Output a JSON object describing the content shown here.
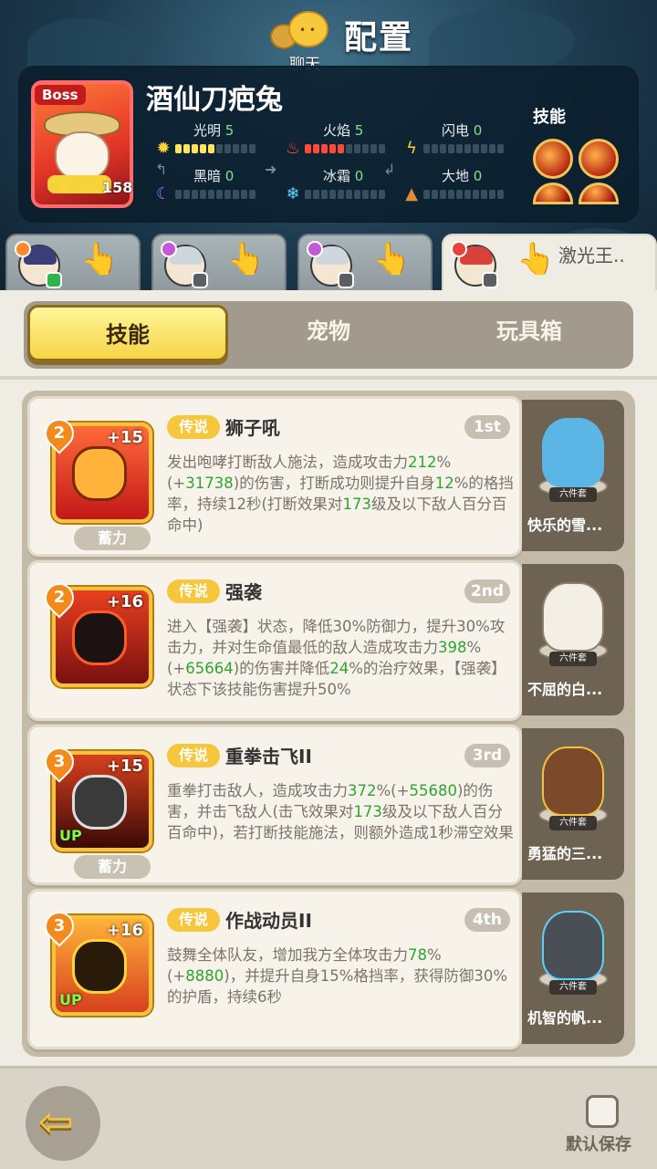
{
  "header": {
    "title": "配置",
    "chat_label": "聊天"
  },
  "boss": {
    "badge": "Boss",
    "name": "酒仙刀疤兔",
    "level": "158",
    "elements": [
      {
        "name": "光明",
        "value": "5",
        "icon": "sun-icon"
      },
      {
        "name": "火焰",
        "value": "5",
        "icon": "fire-icon"
      },
      {
        "name": "闪电",
        "value": "0",
        "icon": "lightning-icon"
      },
      {
        "name": "黑暗",
        "value": "0",
        "icon": "moon-icon"
      },
      {
        "name": "冰霜",
        "value": "0",
        "icon": "snowflake-icon"
      },
      {
        "name": "大地",
        "value": "0",
        "icon": "mountain-icon"
      }
    ],
    "skills_label": "技能"
  },
  "team_tabs": [
    {
      "name": ""
    },
    {
      "name": ""
    },
    {
      "name": ""
    },
    {
      "name": "激光王.."
    }
  ],
  "segments": [
    "技能",
    "宠物",
    "玩具箱"
  ],
  "skills": [
    {
      "level": "2",
      "plus": "+15",
      "rarity": "传说",
      "name": "狮子吼",
      "rank": "1st",
      "tag": "蓄力",
      "up": "",
      "desc_parts": [
        "发出咆哮打断敌人施法，造成攻击力",
        "212",
        "%(+",
        "31738",
        ")的伤害，打断成功则提升自身",
        "12",
        "%的格挡率，持续12秒(打断效果对",
        "173",
        "级及以下敌人百分百命中)"
      ],
      "pet": {
        "name": "快乐的雪...",
        "set": "六件套"
      }
    },
    {
      "level": "2",
      "plus": "+16",
      "rarity": "传说",
      "name": "强袭",
      "rank": "2nd",
      "tag": "",
      "up": "",
      "desc_parts": [
        "进入【强袭】状态，降低30%防御力，提升30%攻击力，并对生命值最低的敌人造成攻击力",
        "398",
        "%(+",
        "65664",
        ")的伤害并降低",
        "24",
        "%的治疗效果，【强袭】状态下该技能伤害提升50%"
      ],
      "pet": {
        "name": "不屈的白...",
        "set": "六件套"
      }
    },
    {
      "level": "3",
      "plus": "+15",
      "rarity": "传说",
      "name": "重拳击飞II",
      "rank": "3rd",
      "tag": "蓄力",
      "up": "UP",
      "desc_parts": [
        "重拳打击敌人，造成攻击力",
        "372",
        "%(+",
        "55680",
        ")的伤害，并击飞敌人(击飞效果对",
        "173",
        "级及以下敌人百分百命中)，若打断技能施法，则额外造成1秒滞空效果"
      ],
      "pet": {
        "name": "勇猛的三...",
        "set": "六件套"
      }
    },
    {
      "level": "3",
      "plus": "+16",
      "rarity": "传说",
      "name": "作战动员II",
      "rank": "4th",
      "tag": "",
      "up": "UP",
      "desc_parts": [
        "鼓舞全体队友，增加我方全体攻击力",
        "78",
        "%(+",
        "8880",
        ")，并提升自身15%格挡率，获得防御30%的护盾，持续6秒"
      ],
      "pet": {
        "name": "机智的帆...",
        "set": "六件套"
      }
    }
  ],
  "footer": {
    "save_label": "默认保存"
  },
  "colors": {
    "accent_yellow": "#f6d547",
    "highlight_green": "#2ea52f",
    "rarity_gold": "#f6c73c"
  }
}
